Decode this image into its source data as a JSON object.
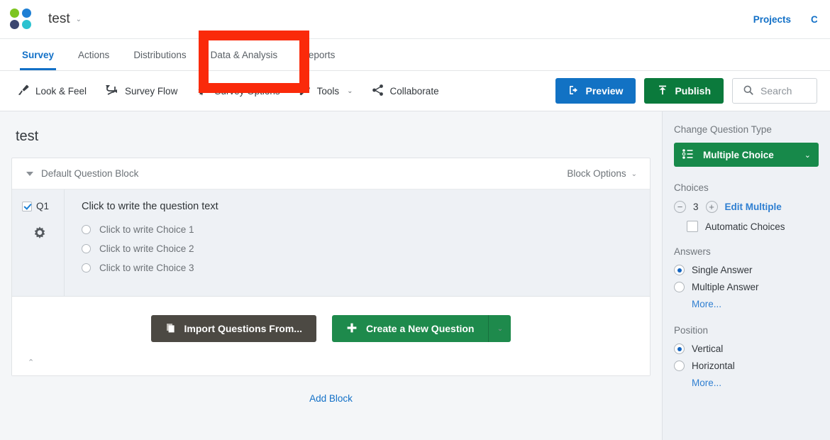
{
  "header": {
    "project_name": "test",
    "project_caret": "⌄",
    "right_links": [
      "Projects"
    ],
    "clipped_link": "C"
  },
  "tabs": [
    {
      "label": "Survey",
      "active": true
    },
    {
      "label": "Actions",
      "active": false
    },
    {
      "label": "Distributions",
      "active": false
    },
    {
      "label": "Data & Analysis",
      "active": false
    },
    {
      "label": "Reports",
      "active": false
    }
  ],
  "toolbar": {
    "items": [
      {
        "label": "Look & Feel",
        "icon": "paintbrush-icon",
        "caret": false
      },
      {
        "label": "Survey Flow",
        "icon": "flow-arrow-icon",
        "caret": false
      },
      {
        "label": "Survey Options",
        "icon": "gear-icon",
        "caret": false
      },
      {
        "label": "Tools",
        "icon": "wrench-icon",
        "caret": true
      },
      {
        "label": "Collaborate",
        "icon": "share-icon",
        "caret": false
      }
    ],
    "caret_glyph": "⌄",
    "preview_label": "Preview",
    "publish_label": "Publish",
    "search_placeholder": "Search"
  },
  "canvas": {
    "survey_name": "test",
    "block": {
      "title": "Default Question Block",
      "options_label": "Block Options",
      "options_caret": "⌄",
      "collapse_caret": "⌃"
    },
    "question": {
      "tag": "Q1",
      "text": "Click to write the question text",
      "choices": [
        "Click to write Choice 1",
        "Click to write Choice 2",
        "Click to write Choice 3"
      ]
    },
    "actions": {
      "import_label": "Import Questions From...",
      "create_label": "Create a New Question",
      "create_caret": "⌄"
    },
    "add_block_label": "Add Block"
  },
  "sidebar": {
    "change_question_type_label": "Change Question Type",
    "question_type_value": "Multiple Choice",
    "question_type_caret": "⌄",
    "choices_label": "Choices",
    "choices_decrement": "−",
    "choices_count": "3",
    "choices_increment": "+",
    "edit_multiple_label": "Edit Multiple",
    "automatic_choices_label": "Automatic Choices",
    "answers_label": "Answers",
    "answers_options": [
      {
        "label": "Single Answer",
        "selected": true
      },
      {
        "label": "Multiple Answer",
        "selected": false
      }
    ],
    "answers_more_label": "More...",
    "position_label": "Position",
    "position_options": [
      {
        "label": "Vertical",
        "selected": true
      },
      {
        "label": "Horizontal",
        "selected": false
      }
    ],
    "position_more_label": "More..."
  },
  "annotation": {
    "type": "red-highlight-rectangle",
    "target": "Data & Analysis",
    "color": "#fa2a0a"
  },
  "colors": {
    "brand_blue": "#1270c7",
    "brand_green": "#17894a",
    "publish_green": "#0b7a3c",
    "import_gray": "#4c4943",
    "annotation_red": "#fa2a0a"
  }
}
